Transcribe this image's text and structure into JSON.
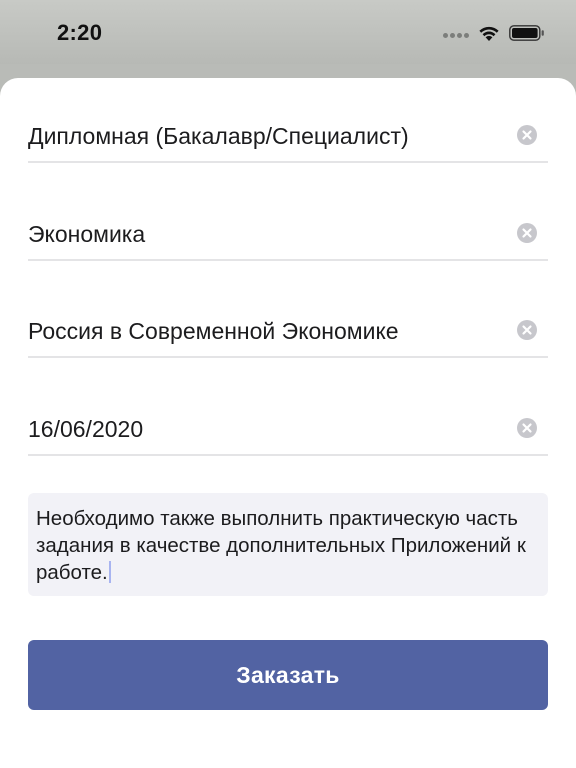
{
  "status_bar": {
    "time": "2:20"
  },
  "form": {
    "fields": [
      {
        "value": "Дипломная (Бакалавр/Специалист)"
      },
      {
        "value": "Экономика"
      },
      {
        "value": "Россия в Современной Экономике"
      },
      {
        "value": "16/06/2020"
      }
    ],
    "comment": "Необходимо также выполнить практическую часть задания в качестве дополнительных Приложений к работе.",
    "submit_label": "Заказать"
  },
  "colors": {
    "accent": "#5263a3",
    "field_background": "#f2f2f7",
    "clear_icon": "#c7c7cc"
  },
  "icons": {
    "status": [
      "signal-dots-icon",
      "wifi-icon",
      "battery-icon"
    ],
    "field_clear": "clear-circle-icon"
  }
}
